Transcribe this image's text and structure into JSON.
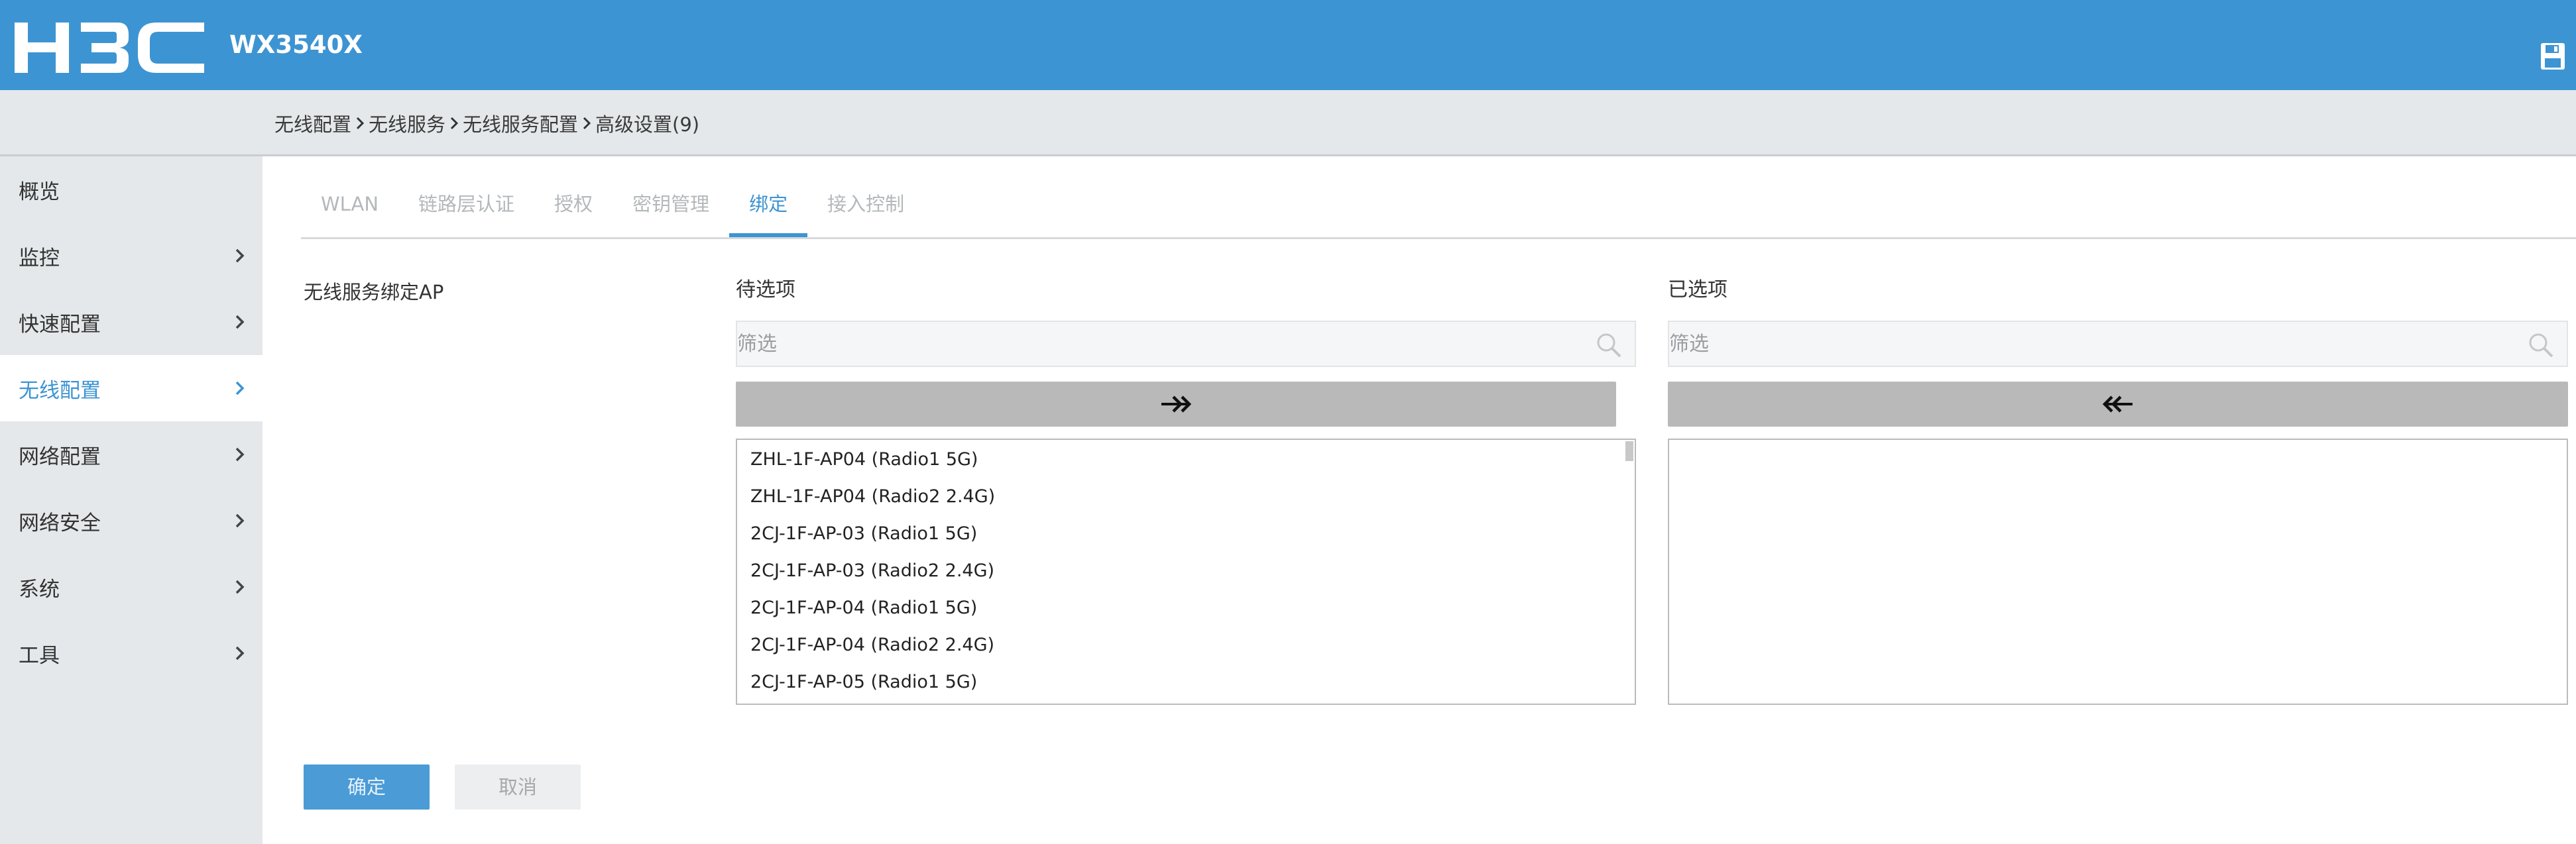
{
  "header": {
    "logo_text": "H3C",
    "model": "WX3540X",
    "save_icon": "save-icon",
    "color": "#3d94d2"
  },
  "breadcrumb": [
    "无线配置",
    "无线服务",
    "无线服务配置",
    "高级设置(9)"
  ],
  "sidebar": {
    "items": [
      {
        "label": "概览",
        "has_arrow": false,
        "active": false
      },
      {
        "label": "监控",
        "has_arrow": true,
        "active": false
      },
      {
        "label": "快速配置",
        "has_arrow": true,
        "active": false
      },
      {
        "label": "无线配置",
        "has_arrow": true,
        "active": true
      },
      {
        "label": "网络配置",
        "has_arrow": true,
        "active": false
      },
      {
        "label": "网络安全",
        "has_arrow": true,
        "active": false
      },
      {
        "label": "系统",
        "has_arrow": true,
        "active": false
      },
      {
        "label": "工具",
        "has_arrow": true,
        "active": false
      }
    ]
  },
  "tabs": [
    {
      "label": "WLAN",
      "active": false
    },
    {
      "label": "链路层认证",
      "active": false
    },
    {
      "label": "授权",
      "active": false
    },
    {
      "label": "密钥管理",
      "active": false
    },
    {
      "label": "绑定",
      "active": true
    },
    {
      "label": "接入控制",
      "active": false
    }
  ],
  "form": {
    "field_label": "无线服务绑定AP",
    "available": {
      "title": "待选项",
      "filter_placeholder": "筛选",
      "items": [
        "ZHL-1F-AP04 (Radio1 5G)",
        "ZHL-1F-AP04 (Radio2 2.4G)",
        "2CJ-1F-AP-03 (Radio1 5G)",
        "2CJ-1F-AP-03 (Radio2 2.4G)",
        "2CJ-1F-AP-04 (Radio1 5G)",
        "2CJ-1F-AP-04 (Radio2 2.4G)",
        "2CJ-1F-AP-05 (Radio1 5G)"
      ]
    },
    "selected": {
      "title": "已选项",
      "filter_placeholder": "筛选",
      "items": []
    },
    "ok_label": "确定",
    "cancel_label": "取消"
  }
}
